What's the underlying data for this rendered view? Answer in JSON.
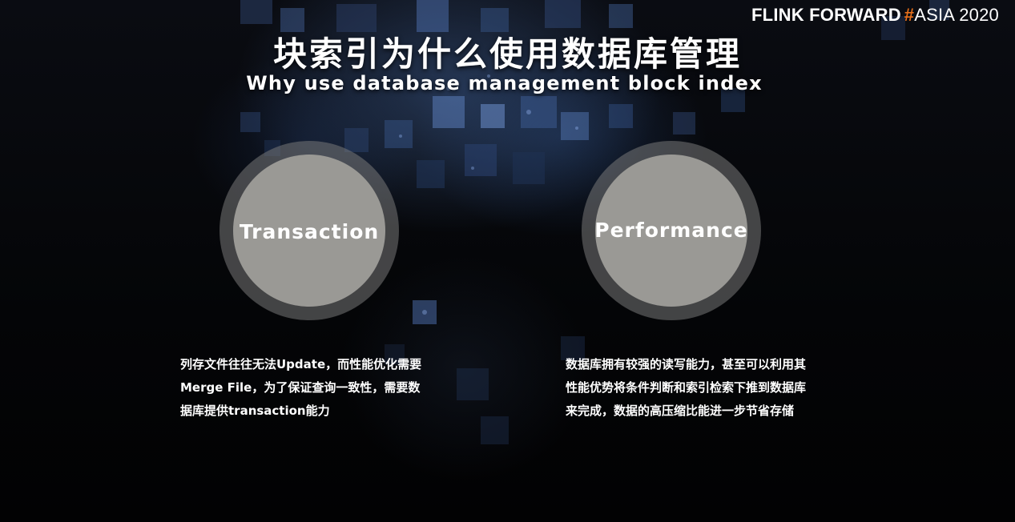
{
  "brand": {
    "name": "FLINK FORWARD",
    "hash": "#",
    "event": "ASIA 2020",
    "accent_color": "#e8701a"
  },
  "title": {
    "cn": "块索引为什么使用数据库管理",
    "en": "Why use database management block index"
  },
  "circles": [
    {
      "label": "Transaction"
    },
    {
      "label": "Performance"
    }
  ],
  "descriptions": [
    {
      "lines": [
        "列存文件往往无法Update，而性能优化需要",
        "Merge File，为了保证查询一致性，需要数",
        "据库提供transaction能力"
      ]
    },
    {
      "lines": [
        "数据库拥有较强的读写能力，甚至可以利用其",
        "性能优势将条件判断和索引检索下推到数据库",
        "来完成，数据的高压缩比能进一步节省存储"
      ]
    }
  ]
}
